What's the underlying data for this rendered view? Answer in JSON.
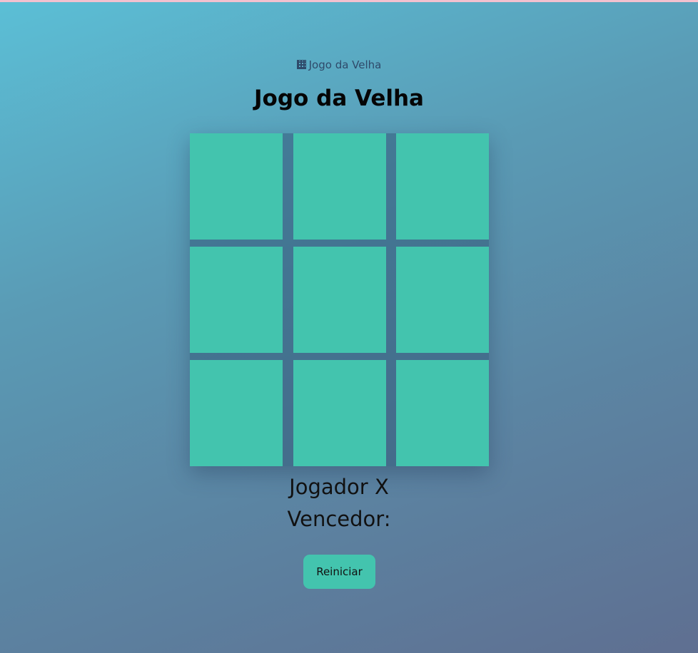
{
  "header": {
    "link_icon": "board-icon",
    "link_text": "Jogo da Velha"
  },
  "title": "Jogo da Velha",
  "board": {
    "cells": [
      "",
      "",
      "",
      "",
      "",
      "",
      "",
      "",
      ""
    ],
    "cell_color": "#43c4ae"
  },
  "status": {
    "player": "Jogador X",
    "winner": "Vencedor:"
  },
  "controls": {
    "reset_label": "Reiniciar"
  },
  "colors": {
    "accent": "#43c4ae",
    "background_start": "#5bbfd6",
    "background_end": "#5f6f91"
  }
}
